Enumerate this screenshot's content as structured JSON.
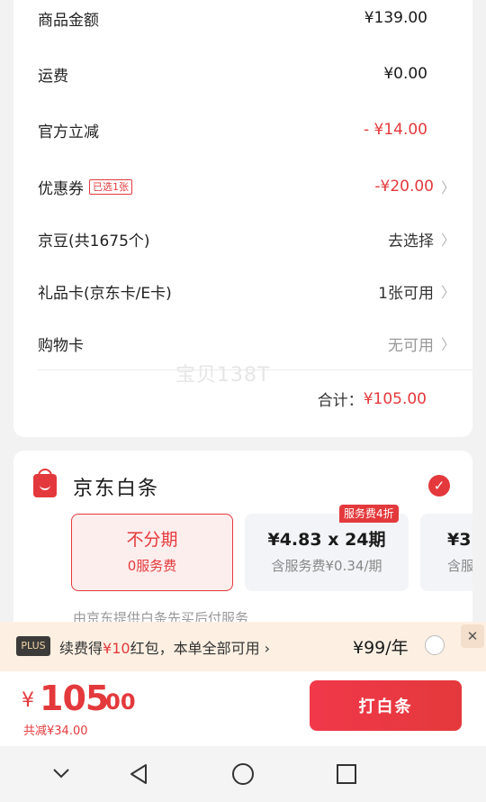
{
  "summary": {
    "rows": [
      {
        "label": "商品金额",
        "value": "¥139.00"
      },
      {
        "label": "运费",
        "value": "¥0.00"
      },
      {
        "label": "官方立减",
        "value": "- ¥14.00"
      },
      {
        "label": "优惠券",
        "tag": "已选1张",
        "value": "-¥20.00"
      },
      {
        "label": "京豆(共1675个)",
        "value": "去选择"
      },
      {
        "label": "礼品卡(京东卡/E卡)",
        "value": "1张可用"
      },
      {
        "label": "购物卡",
        "value": "无可用"
      }
    ],
    "watermark": "宝贝138T",
    "total_label": "合计：",
    "total_value": "¥105.00"
  },
  "baitiao": {
    "title": "京东白条",
    "options": [
      {
        "title": "不分期",
        "sub": "0服务费"
      },
      {
        "title": "¥4.83 x 24期",
        "sub": "含服务费¥0.34/期",
        "badge": "服务费4折"
      },
      {
        "title": "¥3",
        "sub": "含服务"
      }
    ],
    "note": "由京东提供白条先买后付服务"
  },
  "plus": {
    "badge": "PLUS",
    "text_pre": "续费得",
    "text_highlight": "¥10",
    "text_post": "红包，本单全部可用",
    "price": "¥99/年",
    "close": "✕"
  },
  "footer": {
    "price_symbol": "¥",
    "price_int": "105",
    "price_dec": ".00",
    "savings": "共减¥34.00",
    "pay_button": "打白条"
  },
  "nav": [
    "back",
    "home",
    "recents",
    "collapse"
  ],
  "colors": {
    "accent": "#e4393c",
    "plus_bg": "#fdf0e3"
  }
}
